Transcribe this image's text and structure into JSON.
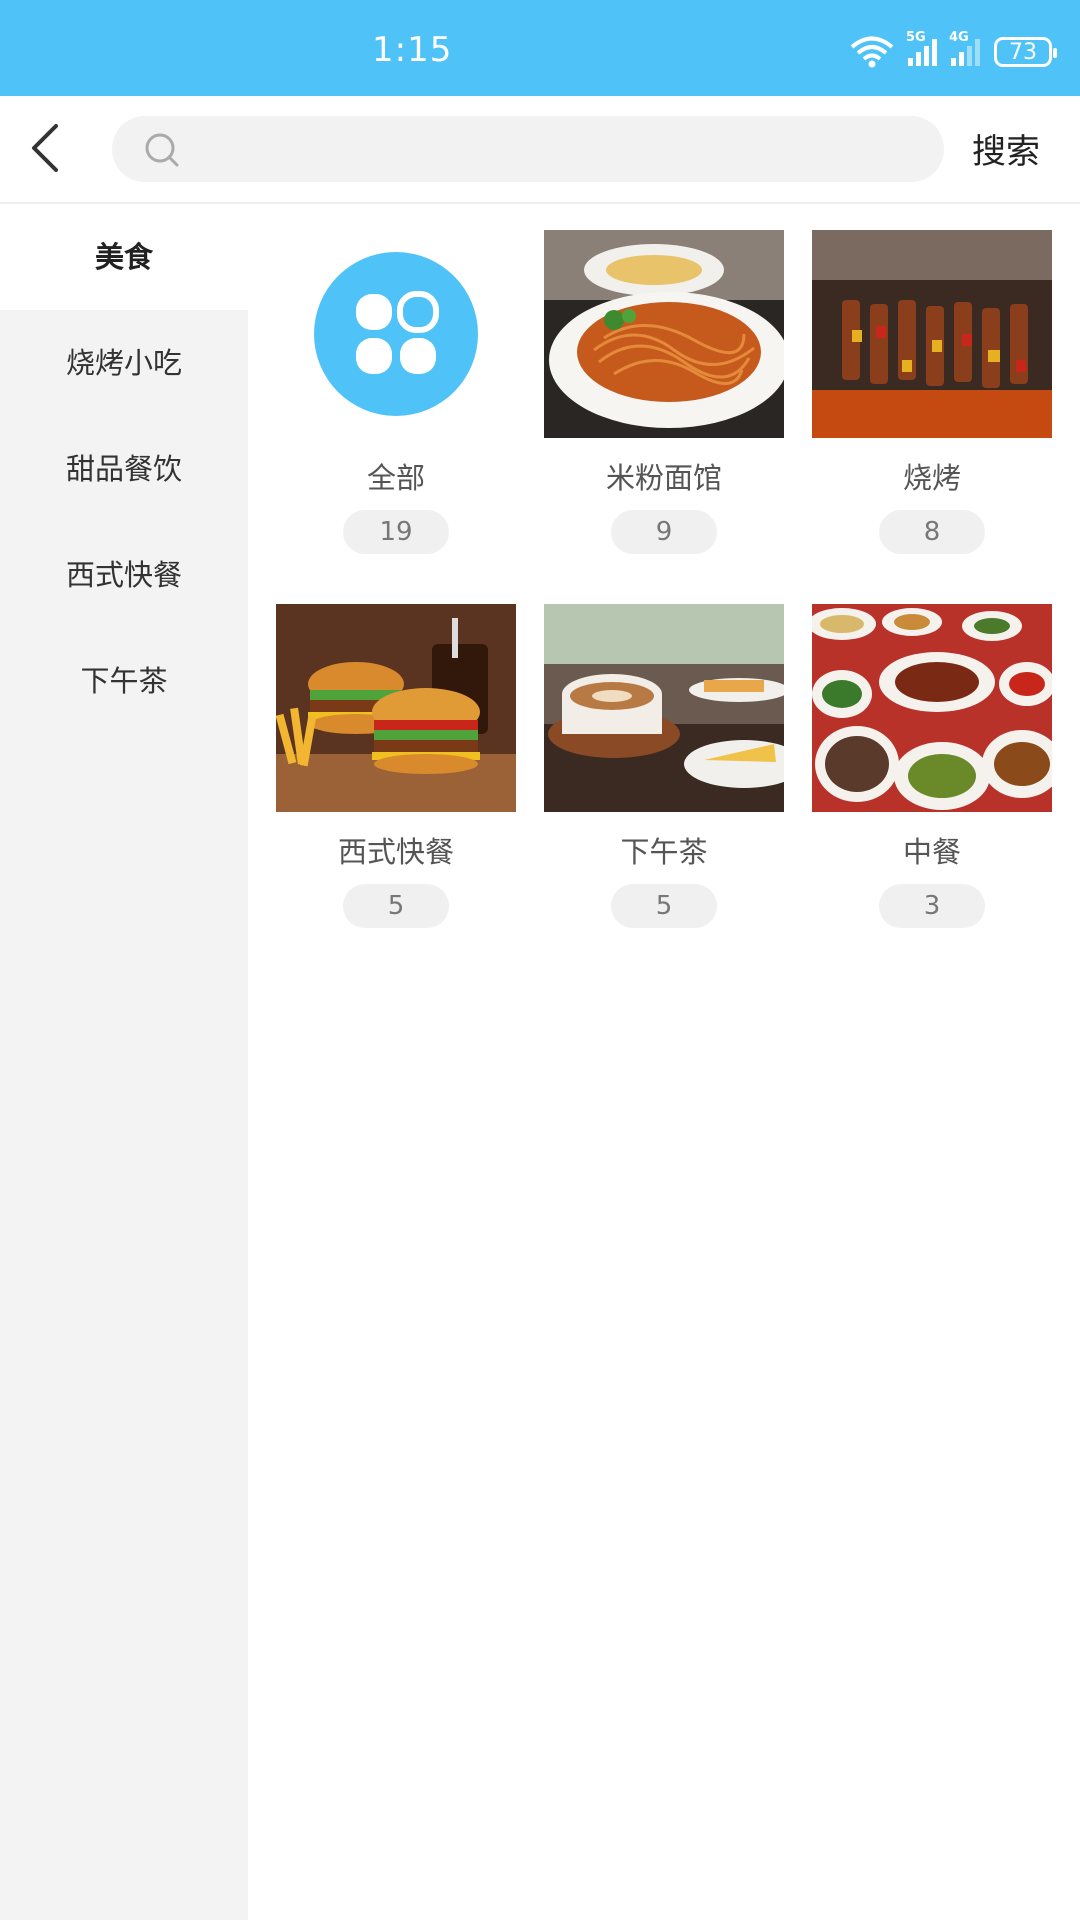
{
  "status": {
    "time": "1:15",
    "battery": "73",
    "net1": "5G",
    "net2": "4G"
  },
  "header": {
    "search_placeholder": "",
    "search_label": "搜索"
  },
  "sidebar": {
    "items": [
      {
        "label": "美食",
        "active": true
      },
      {
        "label": "烧烤小吃",
        "active": false
      },
      {
        "label": "甜品餐饮",
        "active": false
      },
      {
        "label": "西式快餐",
        "active": false
      },
      {
        "label": "下午茶",
        "active": false
      }
    ]
  },
  "categories": [
    {
      "label": "全部",
      "count": "19",
      "icon": "clover-app-icon"
    },
    {
      "label": "米粉面馆",
      "count": "9",
      "image": "spaghetti-photo"
    },
    {
      "label": "烧烤",
      "count": "8",
      "image": "bbq-skewers-photo"
    },
    {
      "label": "西式快餐",
      "count": "5",
      "image": "burger-fries-photo"
    },
    {
      "label": "下午茶",
      "count": "5",
      "image": "coffee-cake-photo"
    },
    {
      "label": "中餐",
      "count": "3",
      "image": "chinese-dishes-photo"
    }
  ],
  "colors": {
    "accent": "#4fc3f7",
    "sidebar_bg": "#f3f3f3"
  }
}
